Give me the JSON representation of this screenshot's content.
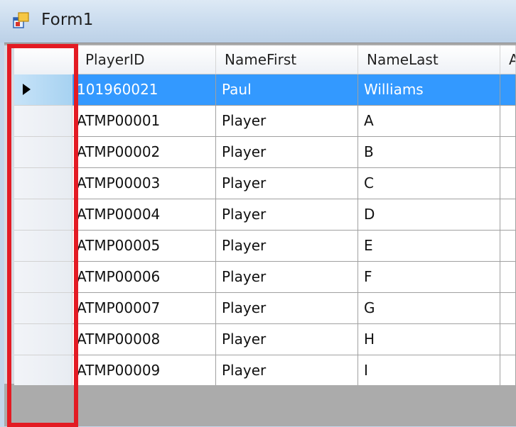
{
  "window": {
    "title": "Form1",
    "icon": "windows-form-icon"
  },
  "grid": {
    "columns": [
      "PlayerID",
      "NameFirst",
      "NameLast",
      "A"
    ],
    "selected_row_index": 0,
    "current_row_marker": "current-row-arrow-icon",
    "rows": [
      [
        "101960021",
        "Paul",
        "Williams",
        ""
      ],
      [
        "ATMP00001",
        "Player",
        "A",
        ""
      ],
      [
        "ATMP00002",
        "Player",
        "B",
        ""
      ],
      [
        "ATMP00003",
        "Player",
        "C",
        ""
      ],
      [
        "ATMP00004",
        "Player",
        "D",
        ""
      ],
      [
        "ATMP00005",
        "Player",
        "E",
        ""
      ],
      [
        "ATMP00006",
        "Player",
        "F",
        ""
      ],
      [
        "ATMP00007",
        "Player",
        "G",
        ""
      ],
      [
        "ATMP00008",
        "Player",
        "H",
        ""
      ],
      [
        "ATMP00009",
        "Player",
        "I",
        ""
      ]
    ]
  },
  "colors": {
    "selection": "#3399ff",
    "highlight_border": "#e31b23",
    "empty_area": "#ababab"
  }
}
